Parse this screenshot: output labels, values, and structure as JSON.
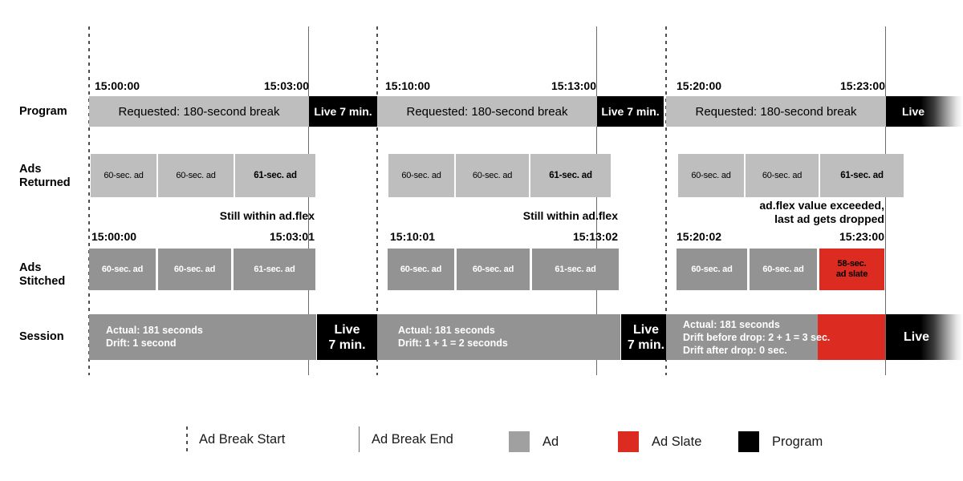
{
  "rows": {
    "program": "Program",
    "ads_returned": "Ads\nReturned",
    "ads_returned_l1": "Ads",
    "ads_returned_l2": "Returned",
    "ads_stitched_l1": "Ads",
    "ads_stitched_l2": "Stitched",
    "session": "Session"
  },
  "segments": [
    {
      "id": "seg1",
      "program": {
        "start_time": "15:00:00",
        "end_time": "15:03:00",
        "break_label": "Requested: 180-second break",
        "live_label": "Live 7 min."
      },
      "ads_returned": [
        {
          "label": "60-sec. ad",
          "bold": false
        },
        {
          "label": "60-sec. ad",
          "bold": false
        },
        {
          "label": "61-sec. ad",
          "bold": true
        }
      ],
      "note": "Still within ad.flex",
      "stitched_start": "15:00:00",
      "stitched_end": "15:03:01",
      "ads_stitched": [
        {
          "label": "60-sec. ad",
          "kind": "ad"
        },
        {
          "label": "60-sec. ad",
          "kind": "ad"
        },
        {
          "label": "61-sec. ad",
          "kind": "ad"
        }
      ],
      "session_lines": [
        "Actual: 181 seconds",
        "Drift: 1 second"
      ],
      "session_live_l1": "Live",
      "session_live_l2": "7 min."
    },
    {
      "id": "seg2",
      "program": {
        "start_time": "15:10:00",
        "end_time": "15:13:00",
        "break_label": "Requested: 180-second break",
        "live_label": "Live 7 min."
      },
      "ads_returned": [
        {
          "label": "60-sec. ad",
          "bold": false
        },
        {
          "label": "60-sec. ad",
          "bold": false
        },
        {
          "label": "61-sec. ad",
          "bold": true
        }
      ],
      "note": "Still within ad.flex",
      "stitched_start": "15:10:01",
      "stitched_end": "15:13:02",
      "ads_stitched": [
        {
          "label": "60-sec. ad",
          "kind": "ad"
        },
        {
          "label": "60-sec. ad",
          "kind": "ad"
        },
        {
          "label": "61-sec. ad",
          "kind": "ad"
        }
      ],
      "session_lines": [
        "Actual: 181 seconds",
        "Drift: 1 + 1 = 2 seconds"
      ],
      "session_live_l1": "Live",
      "session_live_l2": "7 min."
    },
    {
      "id": "seg3",
      "program": {
        "start_time": "15:20:00",
        "end_time": "15:23:00",
        "break_label": "Requested: 180-second break",
        "live_label": "Live"
      },
      "ads_returned": [
        {
          "label": "60-sec. ad",
          "bold": false
        },
        {
          "label": "60-sec. ad",
          "bold": false
        },
        {
          "label": "61-sec. ad",
          "bold": true
        }
      ],
      "note_l1": "ad.flex value exceeded,",
      "note_l2": "last ad gets dropped",
      "stitched_start": "15:20:02",
      "stitched_end": "15:23:00",
      "ads_stitched": [
        {
          "label": "60-sec. ad",
          "kind": "ad"
        },
        {
          "label": "60-sec. ad",
          "kind": "ad"
        },
        {
          "label_l1": "58-sec.",
          "label_l2": "ad slate",
          "kind": "slate"
        }
      ],
      "session_lines": [
        "Actual: 181 seconds",
        "Drift before drop: 2 + 1 = 3 sec.",
        "Drift after drop: 0 sec."
      ],
      "session_live_l1": "Live"
    }
  ],
  "legend": [
    {
      "type": "dotted-line",
      "label": "Ad Break Start"
    },
    {
      "type": "solid-line",
      "label": "Ad Break End"
    },
    {
      "type": "swatch-gray",
      "label": "Ad"
    },
    {
      "type": "swatch-red",
      "label": "Ad Slate"
    },
    {
      "type": "swatch-black",
      "label": "Program"
    }
  ],
  "colors": {
    "ad_gray_light": "#BEBEBE",
    "ad_gray_dark": "#939393",
    "ad_slate_red": "#DC2B20",
    "program_black": "#000000",
    "legend_gray": "#A0A0A0",
    "guide_line": "#6B6B6B"
  }
}
